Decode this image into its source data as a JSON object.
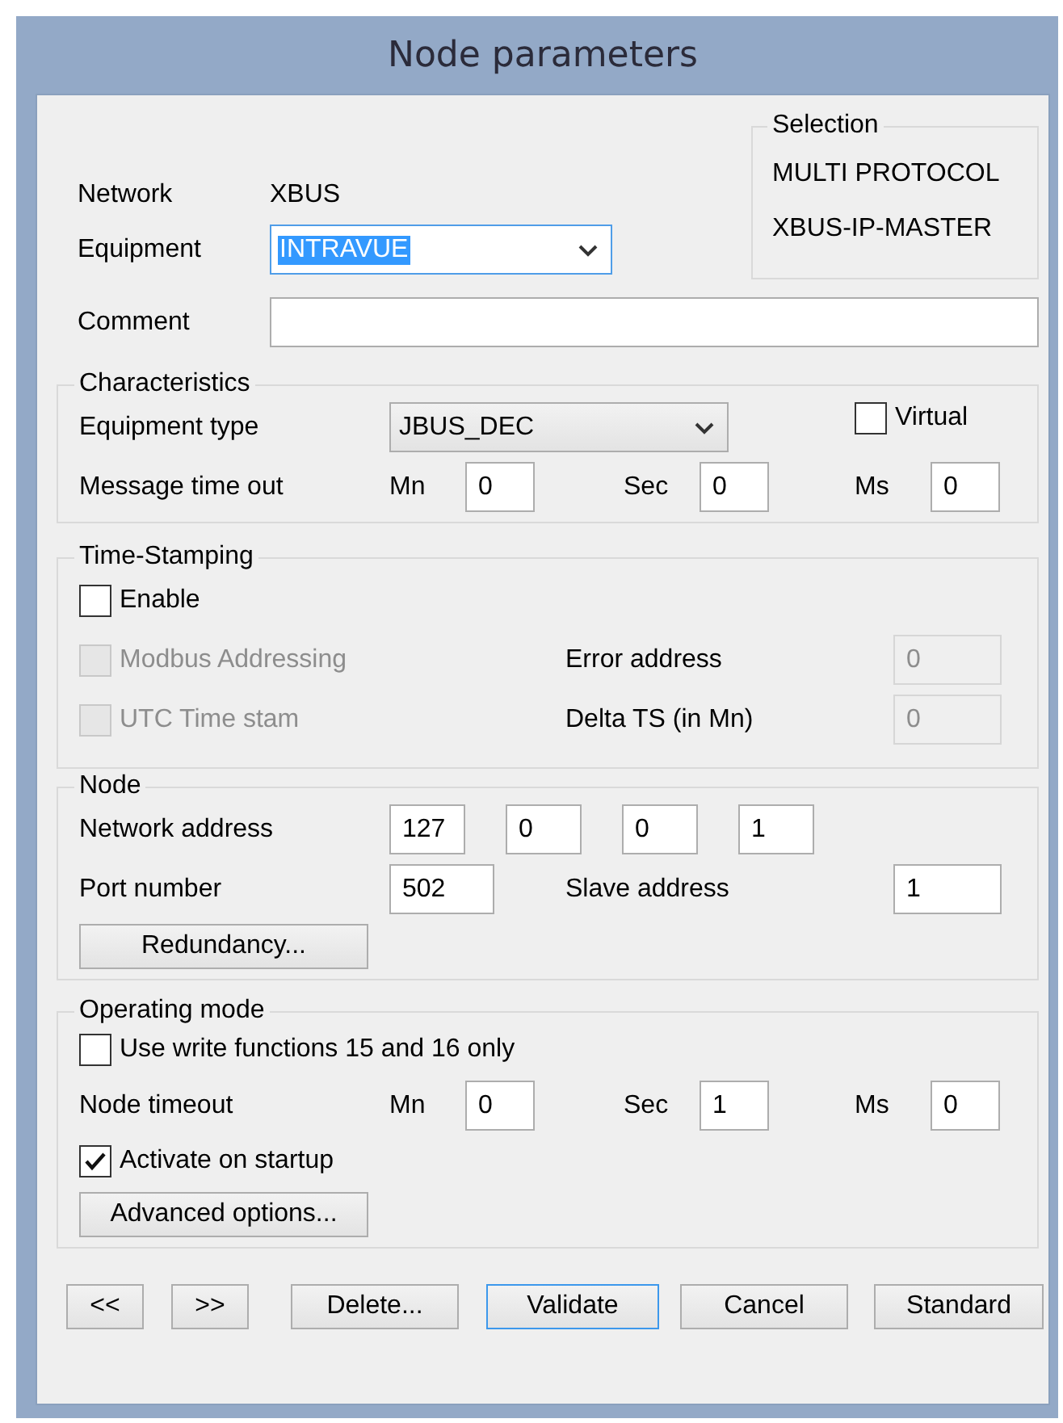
{
  "window": {
    "title": "Node parameters"
  },
  "network": {
    "label": "Network",
    "value": "XBUS"
  },
  "equipment": {
    "label": "Equipment",
    "value": "INTRAVUE",
    "focused": true
  },
  "comment": {
    "label": "Comment"
  },
  "selection": {
    "title": "Selection",
    "lines": [
      "MULTI PROTOCOL",
      "XBUS-IP-MASTER"
    ]
  },
  "characteristics": {
    "title": "Characteristics",
    "equipment_type": {
      "label": "Equipment type",
      "value": "JBUS_DEC"
    },
    "virtual": {
      "label": "Virtual",
      "checked": false,
      "disabled": false
    },
    "message_time_out": {
      "label": "Message time out",
      "fields": [
        {
          "unit": "Mn",
          "value": "0"
        },
        {
          "unit": "Sec",
          "value": "0"
        },
        {
          "unit": "Ms",
          "value": "0"
        }
      ]
    }
  },
  "time_stamping": {
    "title": "Time-Stamping",
    "enable": {
      "label": "Enable",
      "checked": false,
      "disabled": false
    },
    "modbus_addressing": {
      "label": "Modbus Addressing",
      "checked": false,
      "disabled": true
    },
    "utc_time_stamp": {
      "label": "UTC Time stam",
      "checked": false,
      "disabled": true
    },
    "error_address": {
      "label": "Error address",
      "value": "0",
      "disabled": true
    },
    "delta_ts": {
      "label": "Delta TS (in Mn)",
      "value": "0",
      "disabled": true
    }
  },
  "node": {
    "title": "Node",
    "network_address": {
      "label": "Network address",
      "octets": [
        "127",
        "0",
        "0",
        "1"
      ]
    },
    "port_number": {
      "label": "Port number",
      "value": "502"
    },
    "slave_address": {
      "label": "Slave address",
      "value": "1"
    },
    "redundancy_button": "Redundancy..."
  },
  "operating_mode": {
    "title": "Operating mode",
    "write_functions": {
      "label": "Use write functions 15 and 16 only",
      "checked": false,
      "disabled": false
    },
    "node_timeout": {
      "label": "Node timeout",
      "fields": [
        {
          "unit": "Mn",
          "value": "0"
        },
        {
          "unit": "Sec",
          "value": "1"
        },
        {
          "unit": "Ms",
          "value": "0"
        }
      ]
    },
    "activate_on_startup": {
      "label": "Activate on startup",
      "checked": true,
      "disabled": false
    },
    "advanced_button": "Advanced options..."
  },
  "buttons": [
    {
      "label": "<<",
      "focused": false
    },
    {
      "label": ">>",
      "focused": false
    },
    {
      "label": "Delete...",
      "focused": false
    },
    {
      "label": "Validate",
      "focused": true
    },
    {
      "label": "Cancel",
      "focused": false
    },
    {
      "label": "Standard",
      "focused": false
    }
  ]
}
